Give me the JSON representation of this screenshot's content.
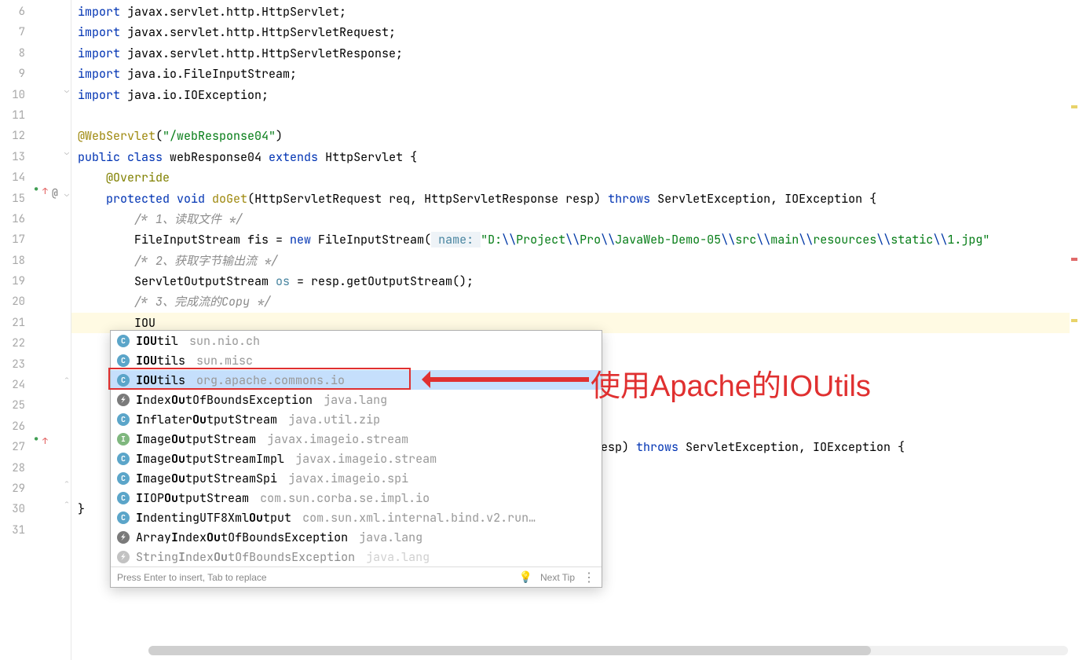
{
  "gutter": {
    "start": 6,
    "end": 31
  },
  "code": {
    "l6": {
      "kw": "import",
      "rest": " javax.servlet.http.HttpServlet;"
    },
    "l7": {
      "kw": "import",
      "rest": " javax.servlet.http.HttpServletRequest;"
    },
    "l8": {
      "kw": "import",
      "rest": " javax.servlet.http.HttpServletResponse;"
    },
    "l9": {
      "kw": "import",
      "rest": " java.io.FileInputStream;"
    },
    "l10": {
      "kw": "import",
      "rest": " java.io.IOException;"
    },
    "l12_ann": "@WebServlet",
    "l12_open": "(",
    "l12_str": "\"/webResponse04\"",
    "l12_close": ")",
    "l13_pub": "public ",
    "l13_cls": "class ",
    "l13_name": "webResponse04 ",
    "l13_ext": "extends ",
    "l13_sup": "HttpServlet {",
    "l14_ann": "@Override",
    "l15_prot": "protected ",
    "l15_void": "void ",
    "l15_m": "doGet",
    "l15_sig": "(HttpServletRequest req, HttpServletResponse resp) ",
    "l15_throws": "throws ",
    "l15_exc": "ServletException, IOException {",
    "l16_cmt": "/* 1、读取文件 */",
    "l17_lead": "FileInputStream fis = ",
    "l17_new": "new ",
    "l17_ctor": "FileInputStream(",
    "l17_hint": " name: ",
    "l17_parts": [
      "\"D:",
      "\\\\",
      "Project",
      "\\\\",
      "Pro",
      "\\\\",
      "JavaWeb-Demo-05",
      "\\\\",
      "src",
      "\\\\",
      "main",
      "\\\\",
      "resources",
      "\\\\",
      "static",
      "\\\\",
      "1.jpg\""
    ],
    "l18_cmt": "/* 2、获取字节输出流 */",
    "l19": "ServletOutputStream ",
    "l19_var": "os",
    "l19_rest": " = resp.getOutputStream();",
    "l20_cmt": "/* 3、完成流的Copy */",
    "l21_typed": "IOU",
    "l27_tail_throws": "throws ",
    "l27_tail_rest": "ServletException, IOException {",
    "l27_mid": "se resp) ",
    "l30_brace": "}"
  },
  "popup": {
    "items": [
      {
        "icon": "c",
        "main": "IOU",
        "rest": "til",
        "pkg": "sun.nio.ch",
        "sel": false
      },
      {
        "icon": "c",
        "main": "IOU",
        "rest": "tils",
        "pkg": "sun.misc",
        "sel": false
      },
      {
        "icon": "c",
        "main": "IOU",
        "rest": "tils",
        "pkg": "org.apache.commons.io",
        "sel": true
      },
      {
        "icon": "ex",
        "main_seg": [
          "I",
          "ndex",
          "Ou",
          "tOfBoundsException"
        ],
        "pkg": "java.lang",
        "sel": false
      },
      {
        "icon": "c",
        "main_seg": [
          "I",
          "nflater",
          "Ou",
          "tputStream"
        ],
        "pkg": "java.util.zip",
        "sel": false
      },
      {
        "icon": "cg",
        "main_seg": [
          "I",
          "mage",
          "Ou",
          "tputStream"
        ],
        "pkg": "javax.imageio.stream",
        "sel": false
      },
      {
        "icon": "c",
        "main_seg": [
          "I",
          "mage",
          "Ou",
          "tputStreamImpl"
        ],
        "pkg": "javax.imageio.stream",
        "sel": false
      },
      {
        "icon": "c",
        "main_seg": [
          "I",
          "mage",
          "Ou",
          "tputStreamSpi"
        ],
        "pkg": "javax.imageio.spi",
        "sel": false
      },
      {
        "icon": "c",
        "main_seg": [
          "I",
          "IOP",
          "Ou",
          "tputStream"
        ],
        "pkg": "com.sun.corba.se.impl.io",
        "sel": false
      },
      {
        "icon": "c",
        "main_seg": [
          "I",
          "ndentingUTF8Xml",
          "Ou",
          "tput"
        ],
        "pkg": "com.sun.xml.internal.bind.v2.run…",
        "sel": false
      },
      {
        "icon": "ex",
        "main_seg": [
          "Array",
          "I",
          "ndex",
          "Ou",
          "tOfBoundsException"
        ],
        "pkg": "java.lang",
        "sel": false
      },
      {
        "icon": "ex",
        "main_seg": [
          "String",
          "I",
          "ndex",
          "Ou",
          "tOfBoundsException"
        ],
        "pkg": "java.lang",
        "sel": false,
        "fade": true
      }
    ],
    "footer_hint": "Press Enter to insert, Tab to replace",
    "footer_link": "Next Tip"
  },
  "annotation": {
    "label": "使用Apache的IOUtils"
  }
}
